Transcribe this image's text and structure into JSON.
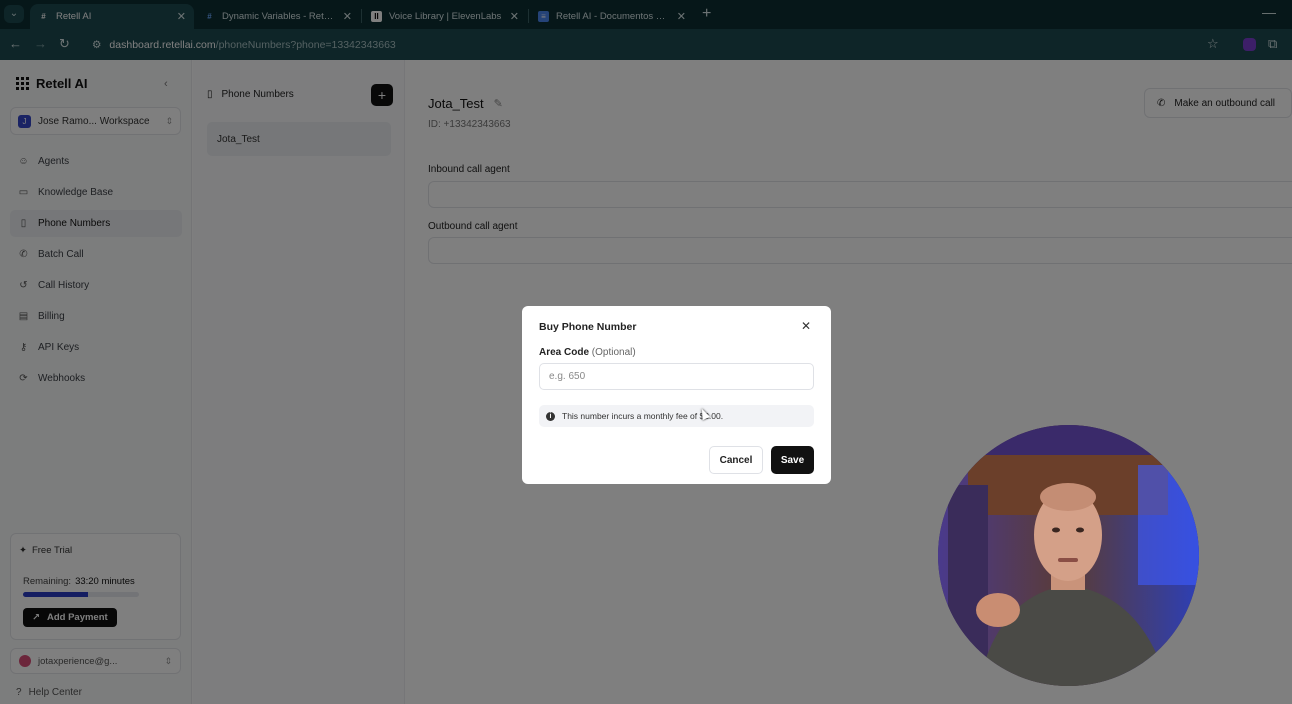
{
  "browser": {
    "tabs": [
      {
        "title": "Retell AI",
        "active": true
      },
      {
        "title": "Dynamic Variables - Retell AI",
        "active": false
      },
      {
        "title": "Voice Library | ElevenLabs",
        "active": false
      },
      {
        "title": "Retell AI - Documentos de Goo",
        "active": false
      }
    ],
    "url_host": "dashboard.retellai.com",
    "url_path": "/phoneNumbers?phone=13342343663"
  },
  "sidebar": {
    "brand": "Retell AI",
    "workspace": "Jose Ramo... Workspace",
    "workspace_initial": "J",
    "items": [
      {
        "label": "Agents",
        "icon": "robot-icon"
      },
      {
        "label": "Knowledge Base",
        "icon": "book-icon"
      },
      {
        "label": "Phone Numbers",
        "icon": "phone-icon",
        "active": true
      },
      {
        "label": "Batch Call",
        "icon": "batch-call-icon"
      },
      {
        "label": "Call History",
        "icon": "history-icon"
      },
      {
        "label": "Billing",
        "icon": "billing-icon"
      },
      {
        "label": "API Keys",
        "icon": "key-icon"
      },
      {
        "label": "Webhooks",
        "icon": "webhook-icon"
      }
    ],
    "trial": {
      "badge": "Free Trial",
      "remaining_label": "Remaining:",
      "remaining_value": "33:20 minutes",
      "remaining_fraction": 0.56,
      "button": "Add Payment"
    },
    "account": "jotaxperience@g...",
    "help": "Help Center"
  },
  "list_panel": {
    "title": "Phone Numbers",
    "items": [
      "Jota_Test"
    ]
  },
  "main": {
    "title": "Jota_Test",
    "id_text": "ID: +13342343663",
    "outbound_button": "Make an outbound call",
    "inbound_label": "Inbound call agent",
    "outbound_label": "Outbound call agent"
  },
  "modal": {
    "title": "Buy Phone Number",
    "area_code_label": "Area Code",
    "area_code_optional": "(Optional)",
    "area_code_placeholder": "e.g. 650",
    "note": "This number incurs a monthly fee of $2.00.",
    "cancel": "Cancel",
    "save": "Save"
  },
  "colors": {
    "chrome_dark": "#0c2e33",
    "chrome_tab": "#1d4a50",
    "accent": "#2b3dc4",
    "primary_button": "#111111"
  }
}
